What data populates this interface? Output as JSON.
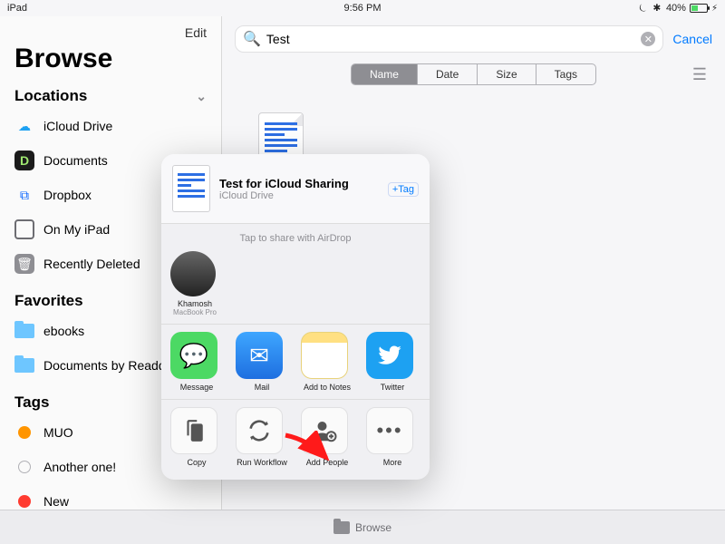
{
  "statusbar": {
    "left": "iPad",
    "time": "9:56 PM",
    "battery": "40%",
    "icons": "⏾ ✱"
  },
  "sidebar": {
    "edit": "Edit",
    "title": "Browse",
    "locations_header": "Locations",
    "locations": [
      {
        "label": "iCloud Drive",
        "icon": "cloud",
        "color": "#1da1f2"
      },
      {
        "label": "Documents",
        "icon": "D",
        "color": "#1b1b1b"
      },
      {
        "label": "Dropbox",
        "icon": "dropbox",
        "color": "#0061ff"
      },
      {
        "label": "On My iPad",
        "icon": "ipad",
        "color": "#6d6d72"
      },
      {
        "label": "Recently Deleted",
        "icon": "trash",
        "color": "#8e8e93"
      }
    ],
    "favorites_header": "Favorites",
    "favorites": [
      {
        "label": "ebooks"
      },
      {
        "label": "Documents by Readd"
      }
    ],
    "tags_header": "Tags",
    "tags": [
      {
        "label": "MUO",
        "color": "#ff9500"
      },
      {
        "label": "Another one!",
        "color": "ring"
      },
      {
        "label": "New",
        "color": "#ff3b30"
      }
    ]
  },
  "content": {
    "search_value": "Test",
    "cancel": "Cancel",
    "sort": {
      "options": [
        "Name",
        "Date",
        "Size",
        "Tags"
      ],
      "active": 0
    }
  },
  "sheet": {
    "name": "Test for iCloud Sharing",
    "location": "iCloud Drive",
    "tag": "+Tag",
    "airdrop_label": "Tap to share with AirDrop",
    "airdrop": [
      {
        "name": "Khamosh",
        "device": "MacBook Pro"
      }
    ],
    "apps": [
      {
        "label": "Message",
        "bg": "#4cd964"
      },
      {
        "label": "Mail",
        "bg": "#1e88e5"
      },
      {
        "label": "Add to Notes",
        "bg": "#ffd54f"
      },
      {
        "label": "Twitter",
        "bg": "#1da1f2"
      }
    ],
    "actions": [
      {
        "label": "Copy"
      },
      {
        "label": "Run Workflow"
      },
      {
        "label": "Add People"
      },
      {
        "label": "More"
      }
    ]
  },
  "bottombar": {
    "label": "Browse"
  }
}
